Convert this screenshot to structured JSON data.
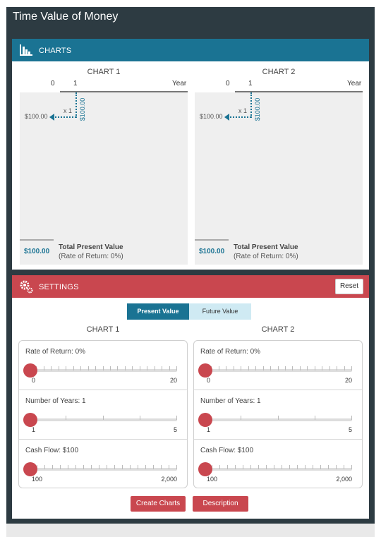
{
  "app": {
    "title": "Time Value of Money"
  },
  "charts_panel": {
    "title": "CHARTS",
    "icon": "bar-chart-icon",
    "charts": [
      {
        "title": "CHART 1",
        "axis_start": "0",
        "axis_one": "1",
        "axis_unit": "Year",
        "multiplier": "x 1",
        "cash_flow": "$100.00",
        "present_value": "$100.00",
        "total_value": "$100.00",
        "total_label": "Total Present Value",
        "rate_note": "(Rate of Return: 0%)"
      },
      {
        "title": "CHART 2",
        "axis_start": "0",
        "axis_one": "1",
        "axis_unit": "Year",
        "multiplier": "x 1",
        "cash_flow": "$100.00",
        "present_value": "$100.00",
        "total_value": "$100.00",
        "total_label": "Total Present Value",
        "rate_note": "(Rate of Return: 0%)"
      }
    ]
  },
  "settings_panel": {
    "title": "SETTINGS",
    "icon": "gears-icon",
    "reset_label": "Reset",
    "mode_toggle": {
      "options": [
        "Present Value",
        "Future Value"
      ],
      "selected": "Present Value"
    },
    "columns": [
      {
        "title": "CHART 1",
        "sliders": [
          {
            "label": "Rate of Return: 0%",
            "min": "0",
            "max": "20",
            "value": 0,
            "ticks": 20
          },
          {
            "label": "Number of Years: 1",
            "min": "1",
            "max": "5",
            "value": 1,
            "ticks": 4
          },
          {
            "label": "Cash Flow: $100",
            "min": "100",
            "max": "2,000",
            "value": 100,
            "ticks": 19
          }
        ]
      },
      {
        "title": "CHART 2",
        "sliders": [
          {
            "label": "Rate of Return: 0%",
            "min": "0",
            "max": "20",
            "value": 0,
            "ticks": 20
          },
          {
            "label": "Number of Years: 1",
            "min": "1",
            "max": "5",
            "value": 1,
            "ticks": 4
          },
          {
            "label": "Cash Flow: $100",
            "min": "100",
            "max": "2,000",
            "value": 100,
            "ticks": 19
          }
        ]
      }
    ],
    "create_label": "Create Charts",
    "description_label": "Description"
  },
  "colors": {
    "teal": "#1a7393",
    "red": "#c9474f",
    "dark": "#2d3b42"
  }
}
